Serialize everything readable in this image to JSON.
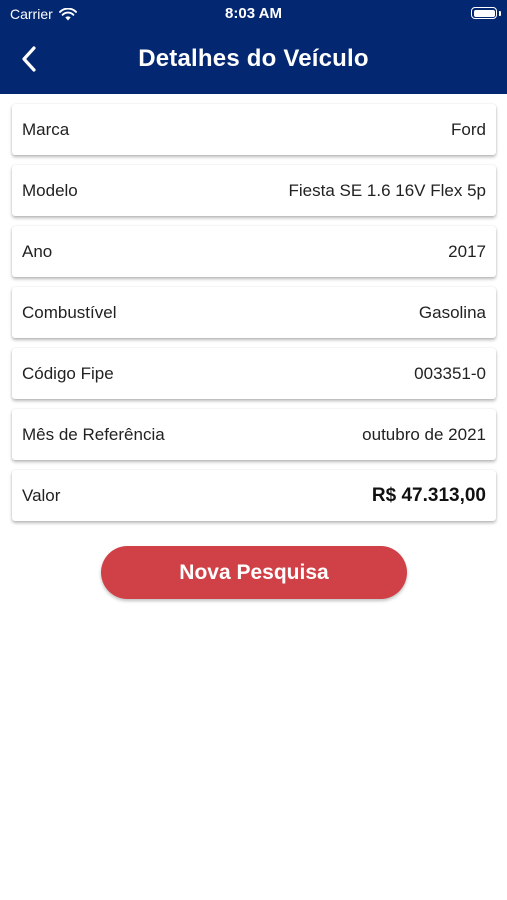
{
  "status_bar": {
    "carrier": "Carrier",
    "time": "8:03 AM",
    "battery_level": 1.0
  },
  "header": {
    "title": "Detalhes do Veículo",
    "back_icon": "chevron-left-icon",
    "background_color": "#032770"
  },
  "details": [
    {
      "label": "Marca",
      "value": "Ford"
    },
    {
      "label": "Modelo",
      "value": "Fiesta SE 1.6 16V Flex 5p"
    },
    {
      "label": "Ano",
      "value": "2017"
    },
    {
      "label": "Combustível",
      "value": "Gasolina"
    },
    {
      "label": "Código Fipe",
      "value": "003351-0"
    },
    {
      "label": "Mês de Referência",
      "value": "outubro de 2021"
    },
    {
      "label": "Valor",
      "value": "R$ 47.313,00"
    }
  ],
  "actions": {
    "new_search_label": "Nova Pesquisa",
    "button_color": "#cf4146"
  }
}
